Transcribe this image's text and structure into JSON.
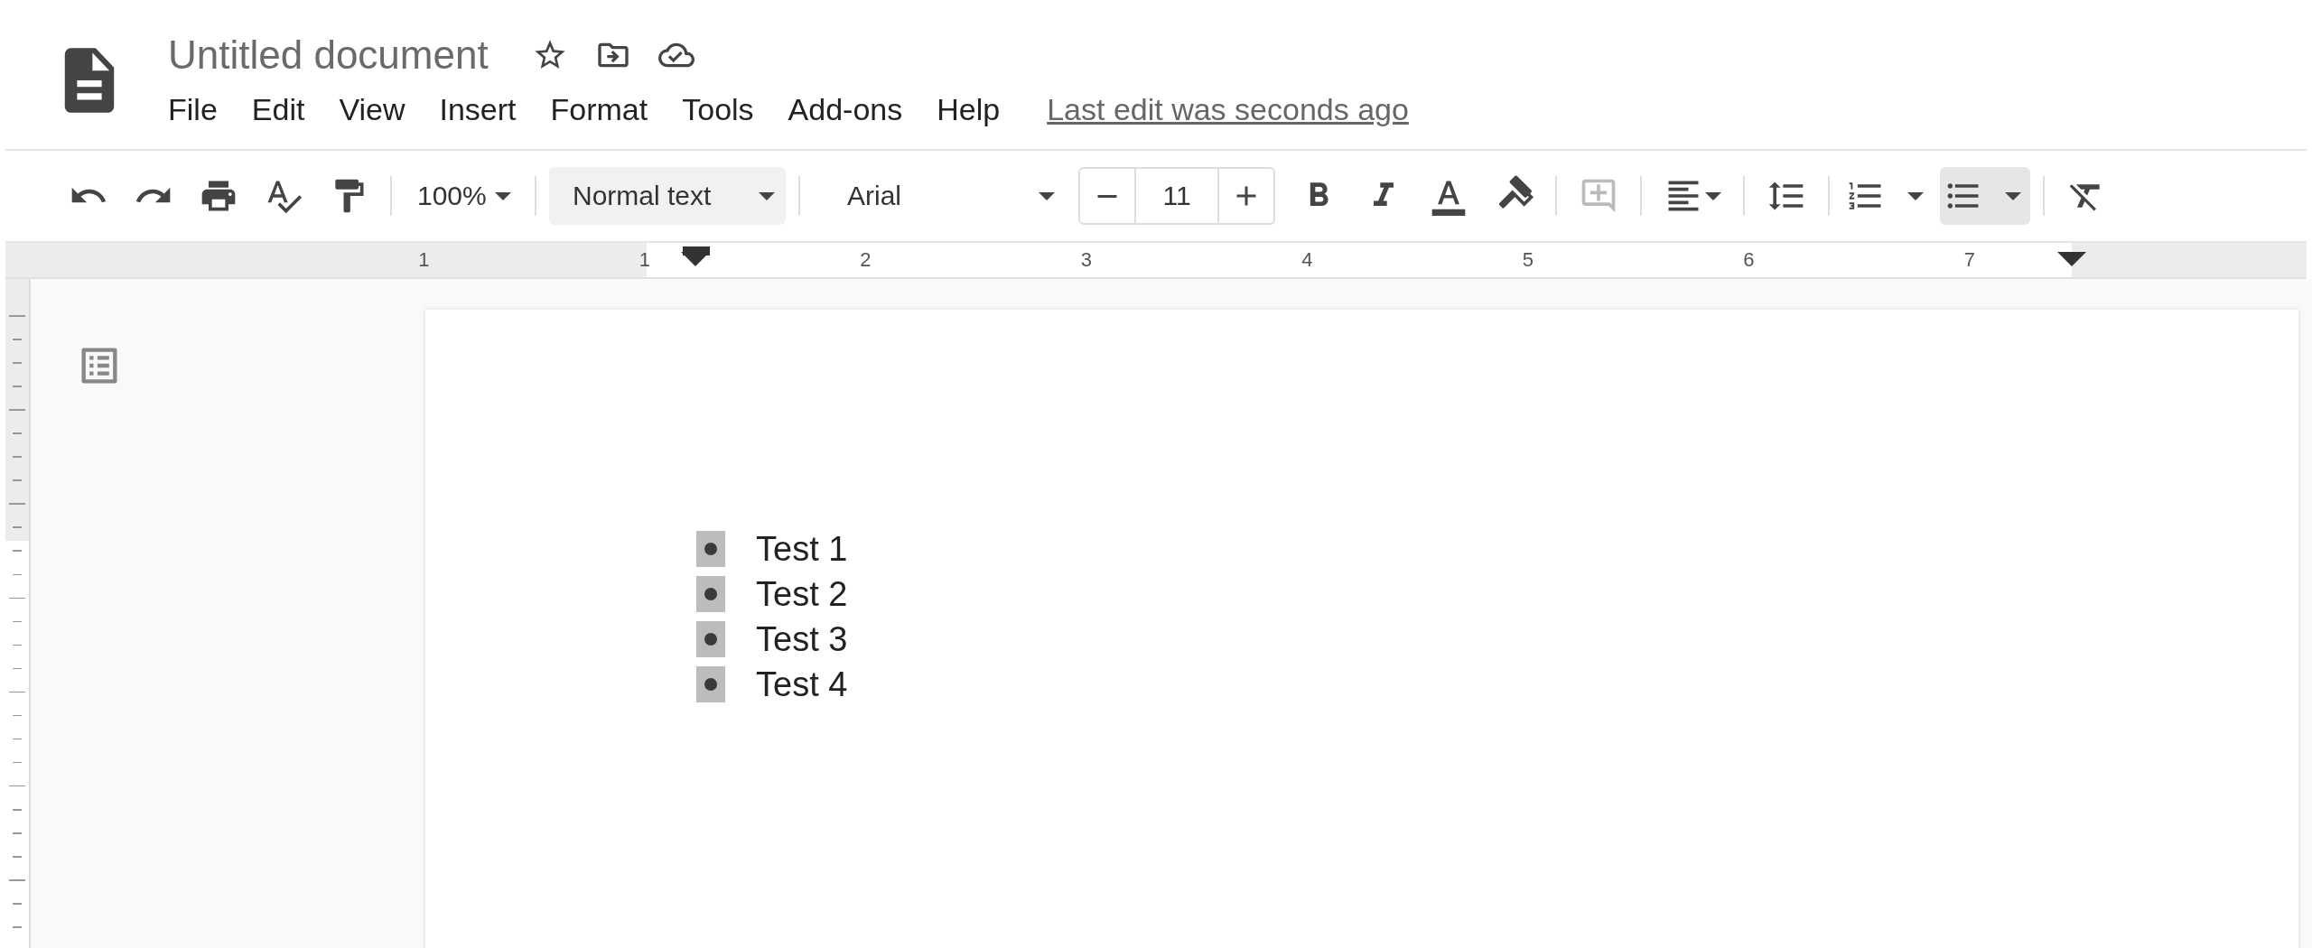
{
  "document": {
    "title": "Untitled document",
    "last_edit": "Last edit was seconds ago"
  },
  "menu": [
    "File",
    "Edit",
    "View",
    "Insert",
    "Format",
    "Tools",
    "Add-ons",
    "Help"
  ],
  "toolbar": {
    "zoom": "100%",
    "style": "Normal text",
    "font": "Arial",
    "font_size": "11",
    "add_comment": {
      "disabled": true
    },
    "lists": [
      {
        "kind": "numbered",
        "selected": false
      },
      {
        "kind": "bulleted",
        "selected": true
      }
    ]
  },
  "ruler": [
    "1",
    "1",
    "2",
    "3",
    "4",
    "5",
    "6",
    "7"
  ],
  "page": {
    "items": [
      {
        "text": "Test 1",
        "selected": true
      },
      {
        "text": "Test 2",
        "selected": true
      },
      {
        "text": "Test 3",
        "selected": true
      },
      {
        "text": "Test 4",
        "selected": true
      }
    ]
  }
}
